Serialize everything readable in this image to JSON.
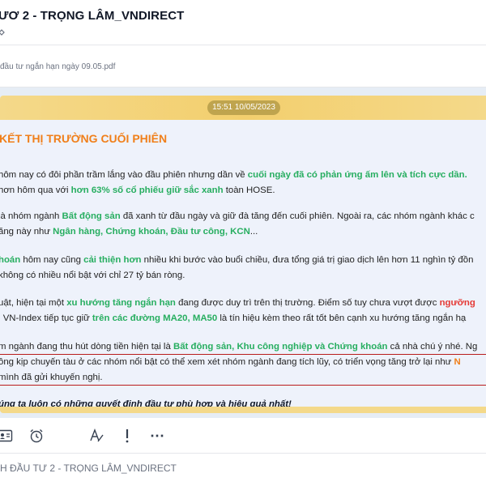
{
  "header": {
    "title": "ƯƠ 2 - TRỌNG LÂM_VNDIRECT"
  },
  "attachment": {
    "file_name": "đầu tư ngắn hạn ngày 09.05.pdf"
  },
  "message": {
    "timestamp": "15:51 10/05/2023",
    "title": "KẾT THỊ TRƯỜNG CUỐI PHIÊN",
    "p1_l1_a": "hôm nay có đôi phần trầm lắng vào đầu phiên nhưng dần về ",
    "p1_l1_b": "cuối ngày đã có phản ứng ấm lên và tích cực dần.",
    "p1_l2_a": "hơn hôm qua với ",
    "p1_l2_b": "hơn 63% số cổ phiếu giữ sắc xanh",
    "p1_l2_c": " toàn HOSE.",
    "p2_l1_a": "là nhóm ngành ",
    "p2_l1_b": "Bất động sản",
    "p2_l1_c": " đã xanh từ đầu ngày và giữ đà tăng đến cuối phiên. Ngoài ra, các nhóm ngành khác c",
    "p2_l2_a": "ăng này như ",
    "p2_l2_b": "Ngân hàng, Chứng khoán, Đầu tư công, KCN",
    "p2_l2_c": "...",
    "p3_l1_a": "hoán",
    "p3_l1_b": " hôm nay cũng ",
    "p3_l1_c": "cải thiện hơn",
    "p3_l1_d": " nhiều khi bước vào buổi chiều, đưa tổng giá trị giao dịch lên hơn 11 nghìn tỷ đồn",
    "p3_l2": " không có nhiều nổi bật với chỉ 27 tỷ bán ròng.",
    "p4_l1_a": "uật, hiện tại một ",
    "p4_l1_b": "xu hướng tăng ngắn hạn",
    "p4_l1_c": " đang được duy trì trên thị trường. Điểm số tuy chưa vượt được ",
    "p4_l1_d": "ngưỡng",
    "p4_l2_a": "i VN-Index tiếp tục giữ ",
    "p4_l2_b": "trên các đường MA20, MA50",
    "p4_l2_c": " là tín hiệu kèm theo rất tốt bên cạnh xu hướng tăng ngắn hạ",
    "p5_l1_a": "m ngành đang thu hút dòng tiền hiện tại là ",
    "p5_l1_b": "Bất động sản, Khu công nghiệp và Chứng khoán",
    "p5_l1_c": " cả nhà chú ý nhé. Ng",
    "p5_l2_a": "ông kịp chuyến tàu ở các nhóm nổi bật có thể xem xét nhóm ngành đang tích lũy, có triển vọng tăng trở lại như ",
    "p5_l2_b": "N",
    "p5_l3": " mình đã gửi khuyến nghị.",
    "closing": "úng ta luôn có những quyết định đầu tư phù hợp và hiệu quả nhất!"
  },
  "toolbar": {
    "icons": [
      "contact-card-icon",
      "alarm-clock-icon",
      "text-format-icon",
      "exclamation-icon",
      "more-icon"
    ],
    "more_label": "⋯"
  },
  "input": {
    "placeholder": "H ĐẦU TƯ 2 - TRỌNG LÂM_VNDIRECT"
  }
}
